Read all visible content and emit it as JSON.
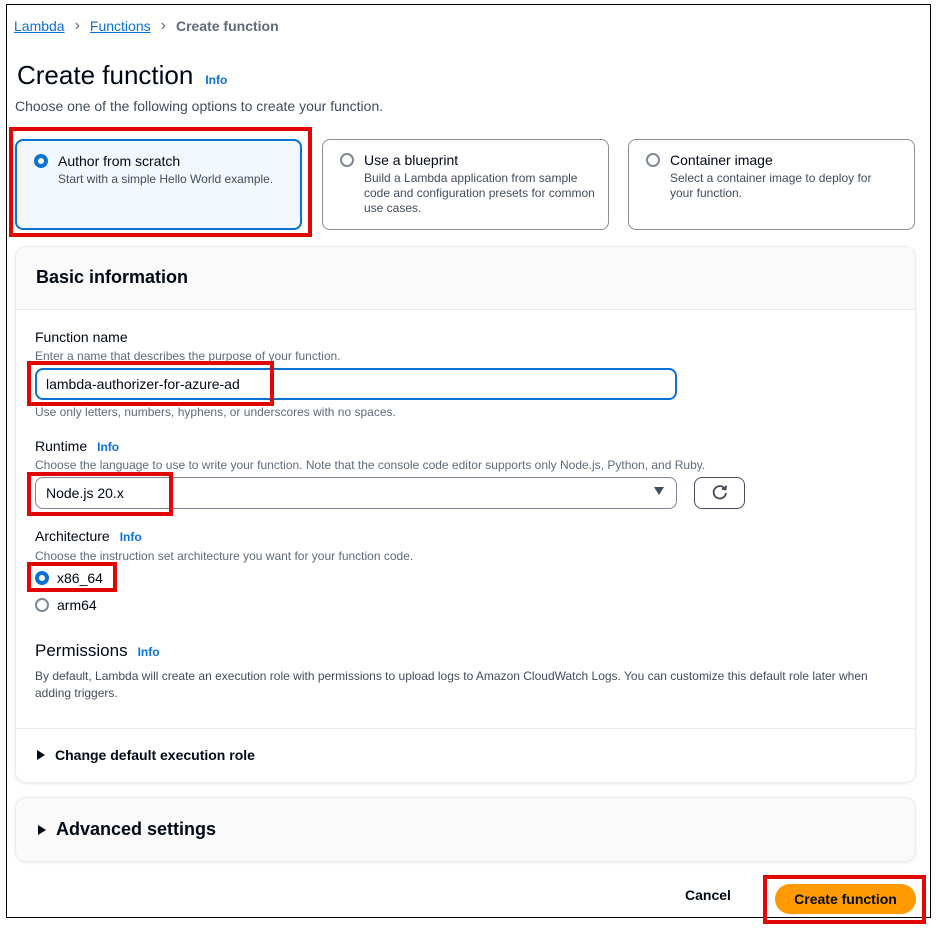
{
  "breadcrumb": {
    "items": [
      "Lambda",
      "Functions"
    ],
    "current": "Create function"
  },
  "header": {
    "title": "Create function",
    "info": "Info",
    "subtitle": "Choose one of the following options to create your function."
  },
  "options": [
    {
      "title": "Author from scratch",
      "desc": "Start with a simple Hello World example.",
      "selected": true
    },
    {
      "title": "Use a blueprint",
      "desc": "Build a Lambda application from sample code and configuration presets for common use cases.",
      "selected": false
    },
    {
      "title": "Container image",
      "desc": "Select a container image to deploy for your function.",
      "selected": false
    }
  ],
  "basic": {
    "heading": "Basic information",
    "function_name": {
      "label": "Function name",
      "description": "Enter a name that describes the purpose of your function.",
      "value": "lambda-authorizer-for-azure-ad",
      "constraint": "Use only letters, numbers, hyphens, or underscores with no spaces."
    },
    "runtime": {
      "label": "Runtime",
      "info": "Info",
      "description": "Choose the language to use to write your function. Note that the console code editor supports only Node.js, Python, and Ruby.",
      "value": "Node.js 20.x"
    },
    "architecture": {
      "label": "Architecture",
      "info": "Info",
      "description": "Choose the instruction set architecture you want for your function code.",
      "options": [
        "x86_64",
        "arm64"
      ],
      "selected": "x86_64"
    },
    "permissions": {
      "label": "Permissions",
      "info": "Info",
      "description": "By default, Lambda will create an execution role with permissions to upload logs to Amazon CloudWatch Logs. You can customize this default role later when adding triggers."
    },
    "change_role": "Change default execution role"
  },
  "advanced": "Advanced settings",
  "footer": {
    "cancel": "Cancel",
    "create": "Create function"
  },
  "colors": {
    "link": "#0972d3",
    "primary": "#ff9900",
    "highlight": "#e10600"
  }
}
